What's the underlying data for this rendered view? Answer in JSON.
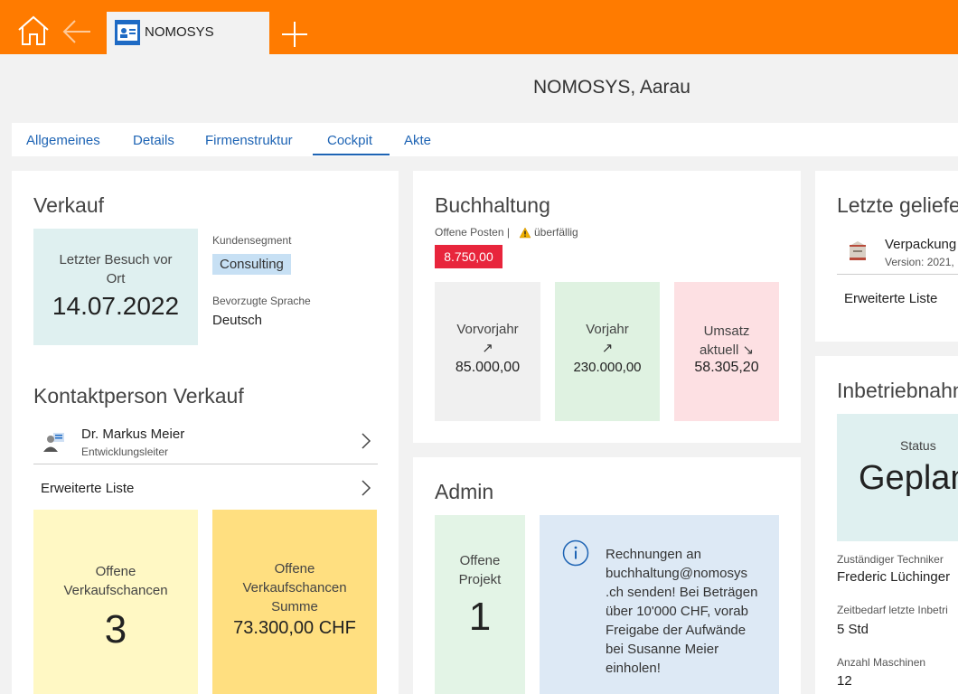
{
  "app": {
    "tab_title": "NOMOSYS",
    "header_title": "NOMOSYS, Aarau"
  },
  "tabs": [
    "Allgemeines",
    "Details",
    "Firmenstruktur",
    "Cockpit",
    "Akte"
  ],
  "active_tab": "Cockpit",
  "verkauf": {
    "title": "Verkauf",
    "last_visit_label": "Letzter Besuch vor Ort",
    "last_visit_date": "14.07.2022",
    "segment_label": "Kundensegment",
    "segment_value": "Consulting",
    "language_label": "Bevorzugte Sprache",
    "language_value": "Deutsch",
    "contact_title": "Kontaktperson Verkauf",
    "contact_name": "Dr. Markus Meier",
    "contact_role": "Entwicklungsleiter",
    "extended_list": "Erweiterte Liste",
    "open_chances_label": "Offene Verkaufschancen",
    "open_chances_value": "3",
    "open_chances_sum_label": "Offene Verkaufschancen Summe",
    "open_chances_sum_value": "73.300,00 CHF"
  },
  "buchhaltung": {
    "title": "Buchhaltung",
    "open_items_label": "Offene Posten |",
    "overdue_label": "überfällig",
    "open_amount": "8.750,00",
    "tiles": [
      {
        "label": "Vorvorjahr",
        "arrow": "↗",
        "value": "85.000,00"
      },
      {
        "label": "Vorjahr",
        "arrow": "↗",
        "value": "230.000,00"
      },
      {
        "label": "Umsatz aktuell",
        "arrow": "↘",
        "value": "58.305,20"
      }
    ]
  },
  "admin": {
    "title": "Admin",
    "open_projects_label": "Offene Projekt",
    "open_projects_value": "1",
    "info_text": "Rechnungen an buchhaltung@nomosys .ch senden! Bei Beträgen über 10'000 CHF, vorab Freigabe der Aufwände bei Susanne Meier einholen!"
  },
  "letzte": {
    "title": "Letzte geliefe",
    "item_name": "Verpackung",
    "item_version": "Version: 2021,",
    "extended_list": "Erweiterte Liste"
  },
  "inbetrieb": {
    "title": "Inbetriebnahn",
    "status_label": "Status",
    "status_value": "Geplan",
    "tech_label": "Zuständiger Techniker",
    "tech_value": "Frederic Lüchinger",
    "time_label": "Zeitbedarf letzte Inbetri",
    "time_value": "5 Std",
    "machines_label": "Anzahl Maschinen",
    "machines_value": "12"
  },
  "colors": {
    "brand_orange": "#ff7b00",
    "accent_blue": "#1e64b4",
    "danger_red": "#e8253c"
  }
}
